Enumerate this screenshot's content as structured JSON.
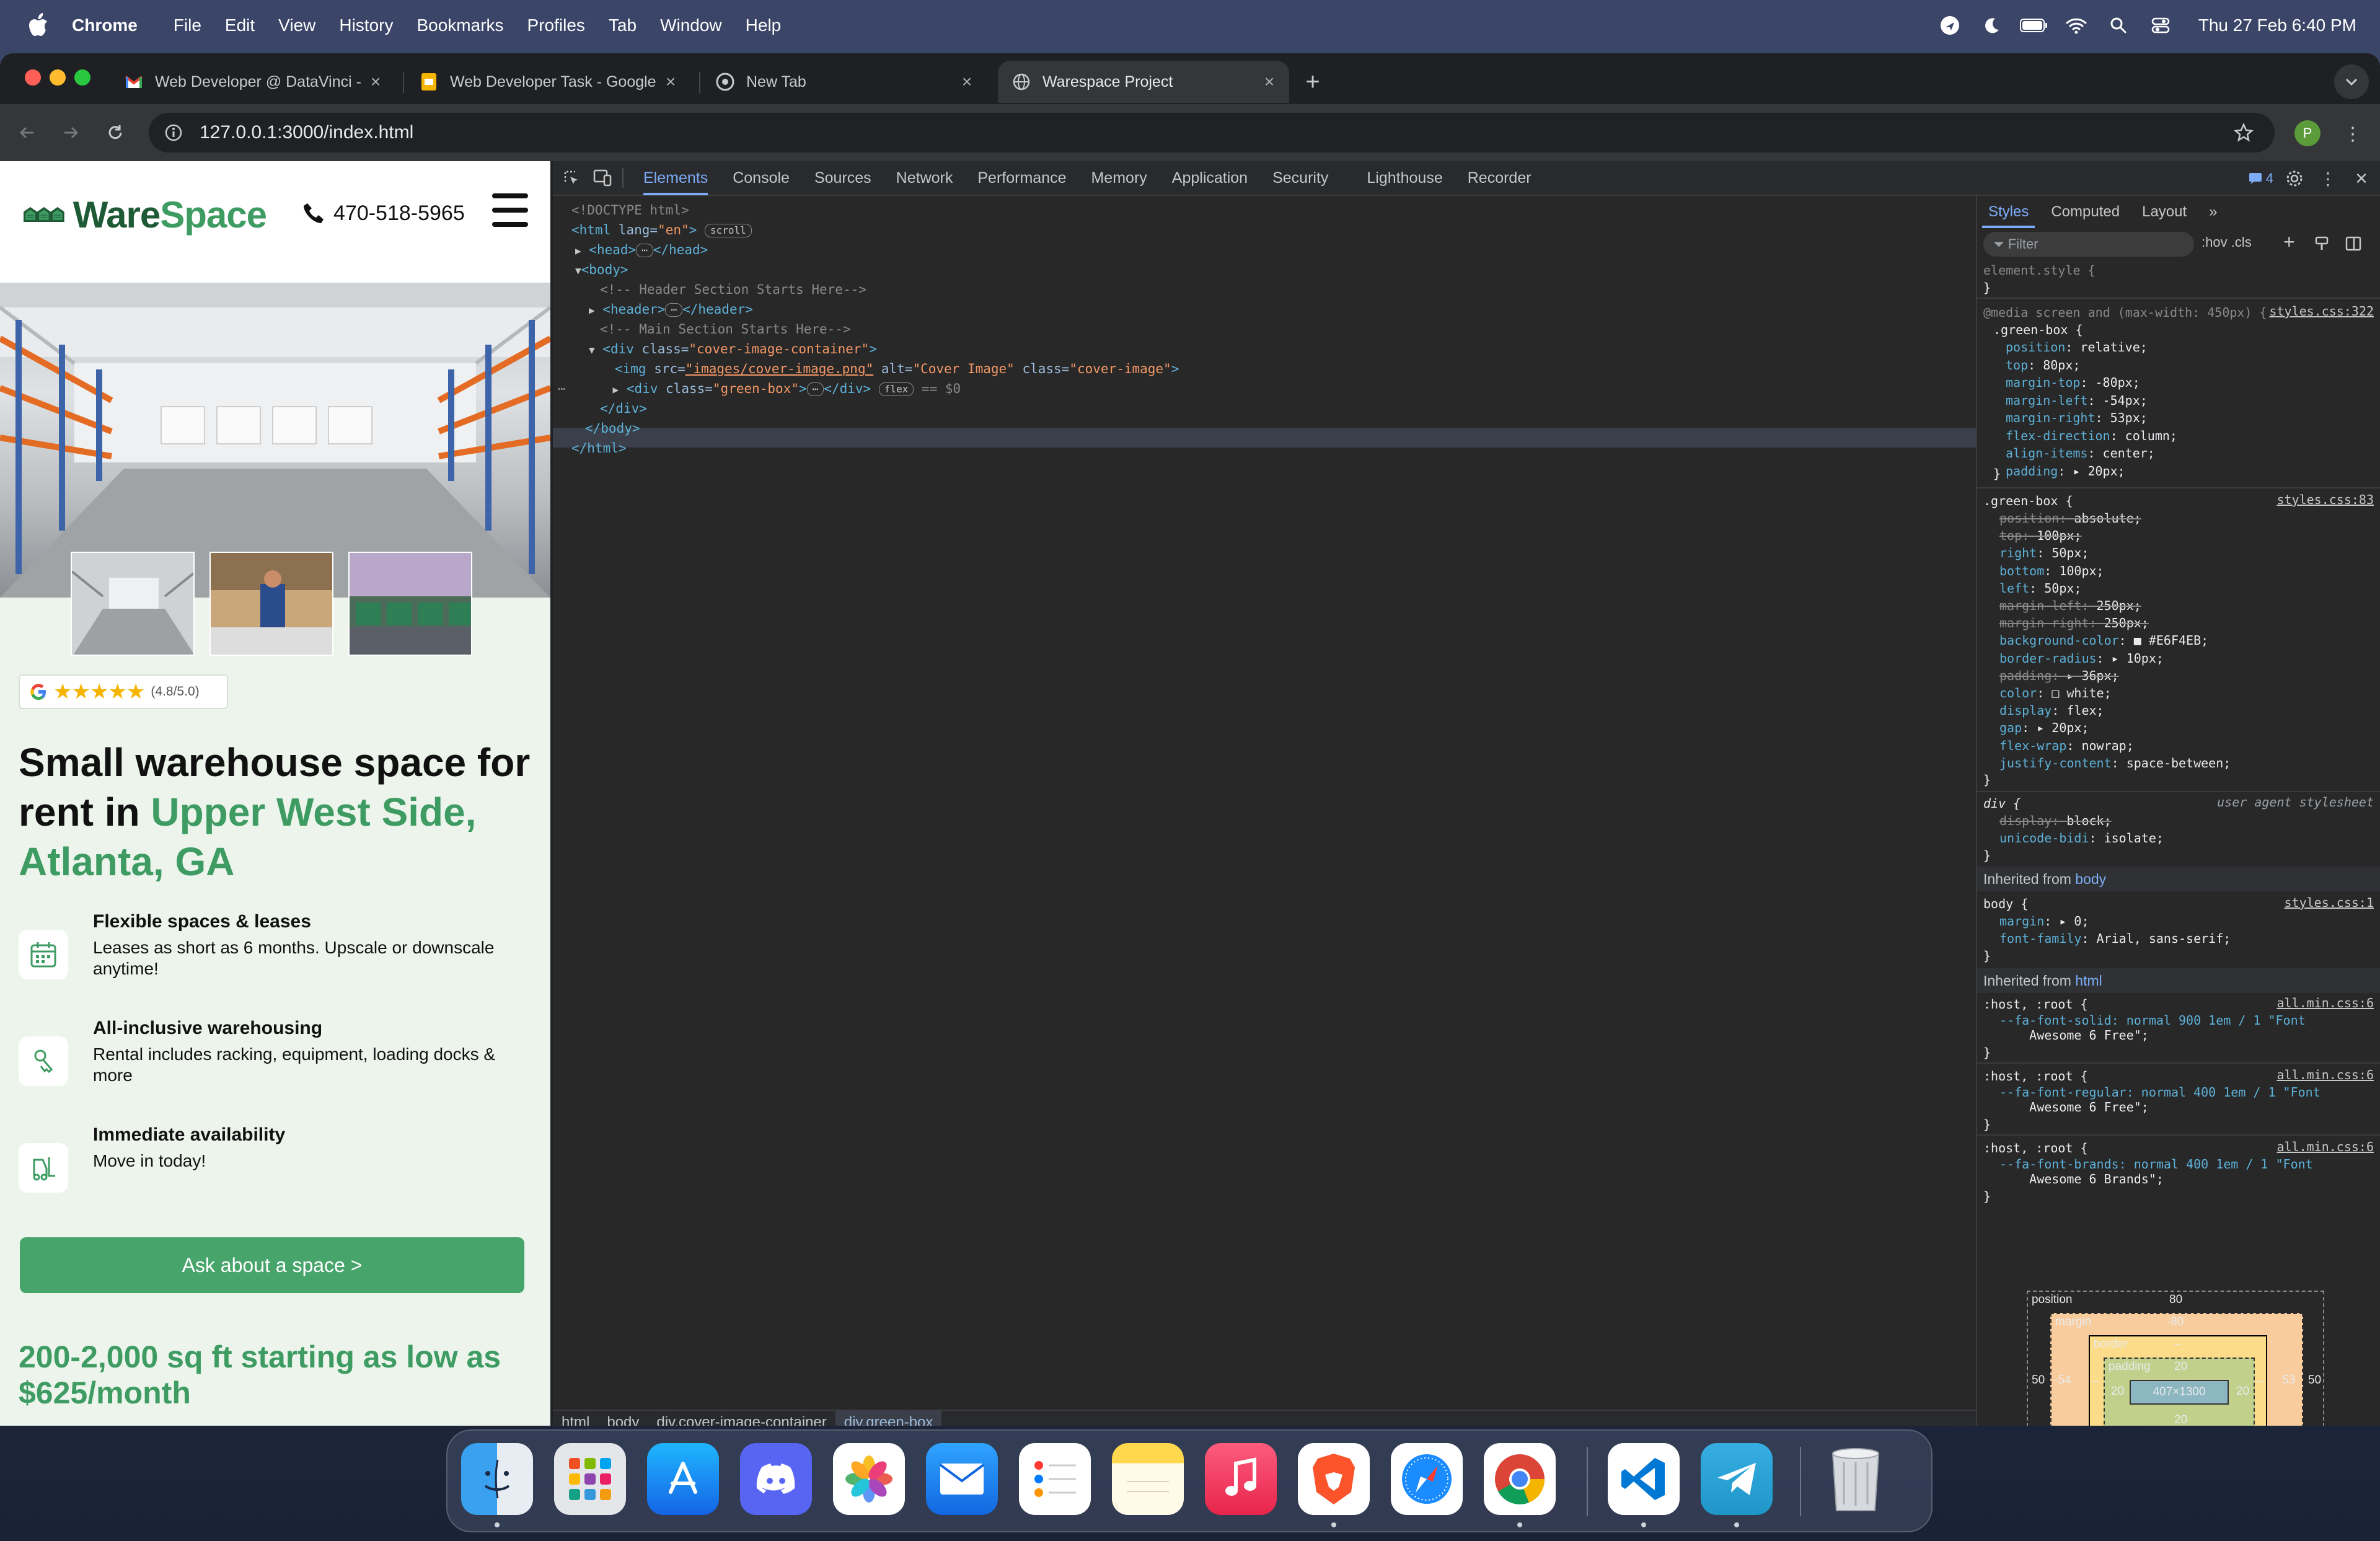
{
  "menubar": {
    "app": "Chrome",
    "items": [
      "File",
      "Edit",
      "View",
      "History",
      "Bookmarks",
      "Profiles",
      "Tab",
      "Window",
      "Help"
    ],
    "clock": "Thu 27 Feb  6:40 PM"
  },
  "browser": {
    "tabs": [
      {
        "title": "Web Developer @ DataVinci -",
        "icon": "gmail-icon"
      },
      {
        "title": "Web Developer Task - Google",
        "icon": "google-slides-icon"
      },
      {
        "title": "New Tab",
        "icon": "chrome-icon"
      },
      {
        "title": "Warespace Project",
        "icon": "globe-icon"
      }
    ],
    "url": "127.0.0.1:3000/index.html",
    "profile_initial": "P"
  },
  "site": {
    "logo_main": "Ware",
    "logo_accent": "Space",
    "phone": "470-518-5965",
    "rating_value": "(4.8/5.0)",
    "rating_stars": "★★★★★",
    "headline_plain": "Small warehouse space for rent in ",
    "headline_accent": "Upper West Side, Atlanta, GA",
    "features": [
      {
        "title": "Flexible spaces & leases",
        "desc": "Leases as short as 6 months. Upscale or downscale anytime!",
        "icon": "calendar-icon"
      },
      {
        "title": "All-inclusive warehousing",
        "desc": "Rental includes racking, equipment, loading docks & more",
        "icon": "hand-key-icon"
      },
      {
        "title": "Immediate availability",
        "desc": "Move in today!",
        "icon": "forklift-icon"
      }
    ],
    "cta": "Ask about a space >",
    "price": "200-2,000 sq ft starting as low as $625/month"
  },
  "devtools": {
    "tabs": [
      "Elements",
      "Console",
      "Sources",
      "Network",
      "Performance",
      "Memory",
      "Application",
      "Security",
      "Lighthouse",
      "Recorder"
    ],
    "active_tab": "Elements",
    "issues_badge": "4",
    "dom": {
      "doctype": "<!DOCTYPE html>",
      "html_open": "<html",
      "html_lang_attr": " lang=",
      "html_lang_val": "\"en\"",
      "scroll_pill": "scroll",
      "head": "<head>",
      "head_close": "</head>",
      "body_open": "<body>",
      "comment_header": "<!-- Header Section Starts Here-->",
      "header": "<header>",
      "header_close": "</header>",
      "comment_main": "<!-- Main Section Starts Here-->",
      "div_cover_tag": "<div",
      "div_cover_attr": " class=",
      "div_cover_val": "\"cover-image-container\"",
      "img_tag": "<img",
      "img_src_attr": " src=",
      "img_src_val": "\"images/cover-image.png\"",
      "img_alt_attr": " alt=",
      "img_alt_val": "\"Cover Image\"",
      "img_class_attr": " class=",
      "img_class_val": "\"cover-image\"",
      "div_green_tag": "<div",
      "div_green_attr": " class=",
      "div_green_val": "\"green-box\"",
      "div_green_close": "</div>",
      "flex_pill": "flex",
      "dollar0": "== $0",
      "div_close": "</div>",
      "body_close": "</body>",
      "html_close": "</html>",
      "ellipsis": "⋯"
    },
    "breadcrumbs": [
      "html",
      "body",
      "div.cover-image-container",
      "div.green-box"
    ],
    "styles_tabs": [
      "Styles",
      "Computed",
      "Layout"
    ],
    "filter_placeholder": "Filter",
    "hov_cls": ":hov  .cls",
    "rules": {
      "element_style": "element.style {",
      "close": "}",
      "media": "@media screen and (max-width: 450px) {",
      "media_src": "styles.css:322",
      "green_box_sel": ".green-box {",
      "media_props": [
        [
          "position",
          "relative;"
        ],
        [
          "top",
          "80px;"
        ],
        [
          "margin-top",
          "-80px;"
        ],
        [
          "margin-left",
          "-54px;"
        ],
        [
          "margin-right",
          "53px;"
        ],
        [
          "flex-direction",
          "column;"
        ],
        [
          "align-items",
          "center;"
        ],
        [
          "padding",
          "▸ 20px;"
        ]
      ],
      "green_src": "styles.css:83",
      "green_props": [
        [
          "position",
          "absolute;",
          true
        ],
        [
          "top",
          "100px;",
          true
        ],
        [
          "right",
          "50px;",
          false
        ],
        [
          "bottom",
          "100px;",
          false
        ],
        [
          "left",
          "50px;",
          false
        ],
        [
          "margin-left",
          "250px;",
          true
        ],
        [
          "margin-right",
          "250px;",
          true
        ],
        [
          "background-color",
          "■ #E6F4EB;",
          false
        ],
        [
          "border-radius",
          "▸ 10px;",
          false
        ],
        [
          "padding",
          "▸ 36px;",
          true
        ],
        [
          "color",
          "□ white;",
          false
        ],
        [
          "display",
          "flex;",
          false
        ],
        [
          "gap",
          "▸ 20px;",
          false
        ],
        [
          "flex-wrap",
          "nowrap;",
          false
        ],
        [
          "justify-content",
          "space-between;",
          false
        ]
      ],
      "div_sel": "div {",
      "ua_label": "user agent stylesheet",
      "div_props": [
        [
          "display",
          "block;",
          true
        ],
        [
          "unicode-bidi",
          "isolate;",
          false
        ]
      ],
      "inherited_body": "Inherited from ",
      "inherited_body_el": "body",
      "body_sel": "body {",
      "body_src": "styles.css:1",
      "body_props": [
        [
          "margin",
          "▸ 0;",
          false
        ],
        [
          "font-family",
          "Arial, sans-serif;",
          false
        ]
      ],
      "inherited_html": "Inherited from ",
      "inherited_html_el": "html",
      "host_sel": ":host, :root {",
      "host_src": "all.min.css:6",
      "fa_solid": "--fa-font-solid: normal 900 1em / 1 \"Font",
      "fa_solid2": "    Awesome 6 Free\";",
      "fa_regular": "--fa-font-regular: normal 400 1em / 1 \"Font",
      "fa_regular2": "    Awesome 6 Free\";",
      "fa_brands": "--fa-font-brands: normal 400 1em / 1 \"Font",
      "fa_brands2": "    Awesome 6 Brands\";"
    },
    "boxmodel": {
      "position_label": "position",
      "position_top": "80",
      "margin_label": "margin",
      "margin_top": "-80",
      "border_label": "border",
      "border_top": "–",
      "padding_label": "padding",
      "padding_top": "20",
      "content": "407×1300",
      "pad_left": "20",
      "pad_right": "20",
      "pad_bottom": "20",
      "margin_left": "-54",
      "margin_right": "53",
      "pos_left": "50",
      "pos_right": "50",
      "border_left": "–",
      "border_right": "–"
    }
  },
  "dock": {
    "apps": [
      "finder-icon",
      "launchpad-icon",
      "app-store-icon",
      "discord-icon",
      "photos-icon",
      "mail-icon",
      "reminders-icon",
      "notes-icon",
      "music-icon",
      "brave-icon",
      "safari-icon",
      "chrome-icon",
      "vscode-icon",
      "telegram-icon",
      "trash-icon"
    ]
  },
  "colors": {
    "accent_green": "#3e9c63",
    "button_green": "#47a46b",
    "page_bg": "#ecf4ec",
    "devtools_accent": "#7cacf8"
  }
}
